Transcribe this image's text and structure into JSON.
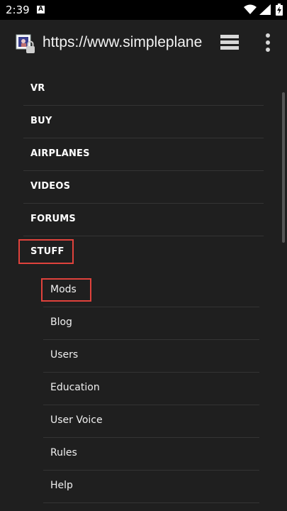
{
  "status_bar": {
    "time": "2:39",
    "notification_icon": "a-icon",
    "icons": [
      "wifi-icon",
      "signal-icon",
      "battery-icon"
    ]
  },
  "browser": {
    "url": "https://www.simpleplanes.com",
    "site_icon": "simpleplanes-site-icon",
    "tabs_icon": "tabs-icon",
    "menu_icon": "more-vert-icon"
  },
  "menu": {
    "items": [
      {
        "label": "VR"
      },
      {
        "label": "BUY"
      },
      {
        "label": "AIRPLANES"
      },
      {
        "label": "VIDEOS"
      },
      {
        "label": "FORUMS"
      },
      {
        "label": "STUFF"
      }
    ],
    "submenu": [
      {
        "label": "Mods"
      },
      {
        "label": "Blog"
      },
      {
        "label": "Users"
      },
      {
        "label": "Education"
      },
      {
        "label": "User Voice"
      },
      {
        "label": "Rules"
      },
      {
        "label": "Help"
      }
    ]
  },
  "colors": {
    "background": "#1f1f1f",
    "highlight": "#e0423c",
    "text": "#ffffff"
  }
}
